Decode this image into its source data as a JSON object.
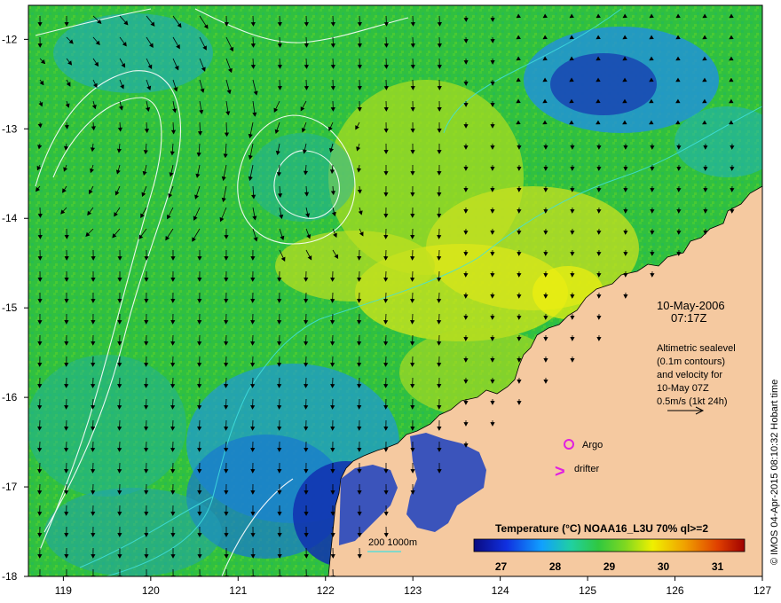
{
  "map": {
    "x_axis": {
      "min": 118.6,
      "max": 127,
      "ticks": [
        "119",
        "120",
        "121",
        "122",
        "123",
        "124",
        "125",
        "126",
        "127"
      ]
    },
    "y_axis": {
      "min": -18,
      "max": -11.62,
      "ticks": [
        "-12",
        "-13",
        "-14",
        "-15",
        "-16",
        "-17",
        "-18"
      ]
    },
    "date_line": "10-May-2006",
    "time_line": "07:17Z",
    "legend_text": [
      "Altimetric sealevel",
      "(0.1m contours)",
      "and velocity for",
      "10-May 07Z",
      "0.5m/s (1kt 24h)"
    ],
    "argo_label": "Argo",
    "drifter_label": "drifter",
    "argo_symbol": "o",
    "drifter_symbol": ">",
    "argo_color": "#e020e0",
    "drifter_color": "#e020e0",
    "depth_contours_label": "200  1000m",
    "colorbar": {
      "title": "Temperature (°C) NOAA16_L3U 70% ql>=2",
      "ticks": [
        "27",
        "28",
        "29",
        "30",
        "31"
      ],
      "min": 26.5,
      "max": 31.5,
      "colors": [
        "#0a0a80",
        "#1030e0",
        "#10a0ff",
        "#20d0a0",
        "#30c840",
        "#80d820",
        "#f0f000",
        "#f0a000",
        "#e04000",
        "#a00000"
      ]
    },
    "credit": "© IMOS 04-Apr-2015 08:10:32 Hobart time",
    "land_color": "#f5c9a0",
    "colors": {
      "sea_green": "#30c040",
      "warm_yellow": "#d8e020",
      "cool_blue": "#2090e0",
      "deep_blue": "#102090",
      "ssh_contour": "#ffffff",
      "bathy_contour": "#40e0e0"
    }
  }
}
